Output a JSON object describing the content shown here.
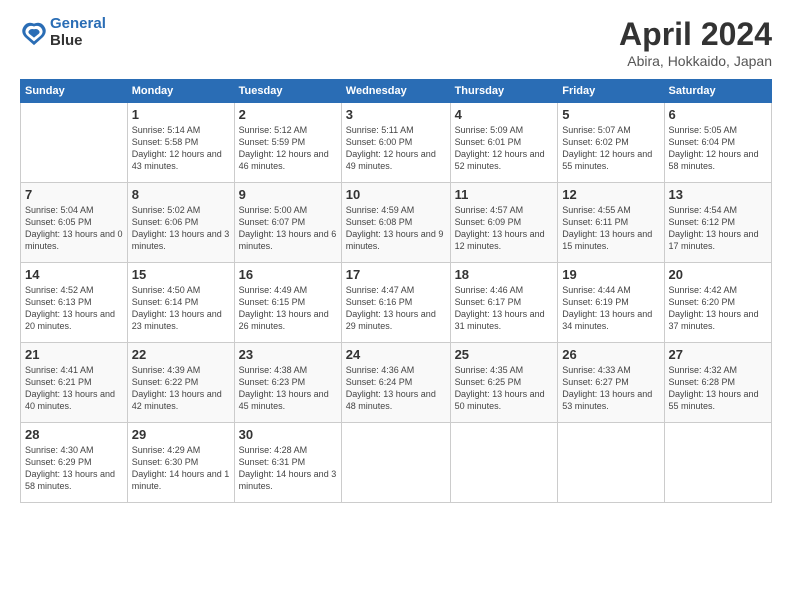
{
  "header": {
    "logo_line1": "General",
    "logo_line2": "Blue",
    "month_title": "April 2024",
    "subtitle": "Abira, Hokkaido, Japan"
  },
  "weekdays": [
    "Sunday",
    "Monday",
    "Tuesday",
    "Wednesday",
    "Thursday",
    "Friday",
    "Saturday"
  ],
  "weeks": [
    [
      {
        "day": "",
        "sunrise": "",
        "sunset": "",
        "daylight": ""
      },
      {
        "day": "1",
        "sunrise": "Sunrise: 5:14 AM",
        "sunset": "Sunset: 5:58 PM",
        "daylight": "Daylight: 12 hours and 43 minutes."
      },
      {
        "day": "2",
        "sunrise": "Sunrise: 5:12 AM",
        "sunset": "Sunset: 5:59 PM",
        "daylight": "Daylight: 12 hours and 46 minutes."
      },
      {
        "day": "3",
        "sunrise": "Sunrise: 5:11 AM",
        "sunset": "Sunset: 6:00 PM",
        "daylight": "Daylight: 12 hours and 49 minutes."
      },
      {
        "day": "4",
        "sunrise": "Sunrise: 5:09 AM",
        "sunset": "Sunset: 6:01 PM",
        "daylight": "Daylight: 12 hours and 52 minutes."
      },
      {
        "day": "5",
        "sunrise": "Sunrise: 5:07 AM",
        "sunset": "Sunset: 6:02 PM",
        "daylight": "Daylight: 12 hours and 55 minutes."
      },
      {
        "day": "6",
        "sunrise": "Sunrise: 5:05 AM",
        "sunset": "Sunset: 6:04 PM",
        "daylight": "Daylight: 12 hours and 58 minutes."
      }
    ],
    [
      {
        "day": "7",
        "sunrise": "Sunrise: 5:04 AM",
        "sunset": "Sunset: 6:05 PM",
        "daylight": "Daylight: 13 hours and 0 minutes."
      },
      {
        "day": "8",
        "sunrise": "Sunrise: 5:02 AM",
        "sunset": "Sunset: 6:06 PM",
        "daylight": "Daylight: 13 hours and 3 minutes."
      },
      {
        "day": "9",
        "sunrise": "Sunrise: 5:00 AM",
        "sunset": "Sunset: 6:07 PM",
        "daylight": "Daylight: 13 hours and 6 minutes."
      },
      {
        "day": "10",
        "sunrise": "Sunrise: 4:59 AM",
        "sunset": "Sunset: 6:08 PM",
        "daylight": "Daylight: 13 hours and 9 minutes."
      },
      {
        "day": "11",
        "sunrise": "Sunrise: 4:57 AM",
        "sunset": "Sunset: 6:09 PM",
        "daylight": "Daylight: 13 hours and 12 minutes."
      },
      {
        "day": "12",
        "sunrise": "Sunrise: 4:55 AM",
        "sunset": "Sunset: 6:11 PM",
        "daylight": "Daylight: 13 hours and 15 minutes."
      },
      {
        "day": "13",
        "sunrise": "Sunrise: 4:54 AM",
        "sunset": "Sunset: 6:12 PM",
        "daylight": "Daylight: 13 hours and 17 minutes."
      }
    ],
    [
      {
        "day": "14",
        "sunrise": "Sunrise: 4:52 AM",
        "sunset": "Sunset: 6:13 PM",
        "daylight": "Daylight: 13 hours and 20 minutes."
      },
      {
        "day": "15",
        "sunrise": "Sunrise: 4:50 AM",
        "sunset": "Sunset: 6:14 PM",
        "daylight": "Daylight: 13 hours and 23 minutes."
      },
      {
        "day": "16",
        "sunrise": "Sunrise: 4:49 AM",
        "sunset": "Sunset: 6:15 PM",
        "daylight": "Daylight: 13 hours and 26 minutes."
      },
      {
        "day": "17",
        "sunrise": "Sunrise: 4:47 AM",
        "sunset": "Sunset: 6:16 PM",
        "daylight": "Daylight: 13 hours and 29 minutes."
      },
      {
        "day": "18",
        "sunrise": "Sunrise: 4:46 AM",
        "sunset": "Sunset: 6:17 PM",
        "daylight": "Daylight: 13 hours and 31 minutes."
      },
      {
        "day": "19",
        "sunrise": "Sunrise: 4:44 AM",
        "sunset": "Sunset: 6:19 PM",
        "daylight": "Daylight: 13 hours and 34 minutes."
      },
      {
        "day": "20",
        "sunrise": "Sunrise: 4:42 AM",
        "sunset": "Sunset: 6:20 PM",
        "daylight": "Daylight: 13 hours and 37 minutes."
      }
    ],
    [
      {
        "day": "21",
        "sunrise": "Sunrise: 4:41 AM",
        "sunset": "Sunset: 6:21 PM",
        "daylight": "Daylight: 13 hours and 40 minutes."
      },
      {
        "day": "22",
        "sunrise": "Sunrise: 4:39 AM",
        "sunset": "Sunset: 6:22 PM",
        "daylight": "Daylight: 13 hours and 42 minutes."
      },
      {
        "day": "23",
        "sunrise": "Sunrise: 4:38 AM",
        "sunset": "Sunset: 6:23 PM",
        "daylight": "Daylight: 13 hours and 45 minutes."
      },
      {
        "day": "24",
        "sunrise": "Sunrise: 4:36 AM",
        "sunset": "Sunset: 6:24 PM",
        "daylight": "Daylight: 13 hours and 48 minutes."
      },
      {
        "day": "25",
        "sunrise": "Sunrise: 4:35 AM",
        "sunset": "Sunset: 6:25 PM",
        "daylight": "Daylight: 13 hours and 50 minutes."
      },
      {
        "day": "26",
        "sunrise": "Sunrise: 4:33 AM",
        "sunset": "Sunset: 6:27 PM",
        "daylight": "Daylight: 13 hours and 53 minutes."
      },
      {
        "day": "27",
        "sunrise": "Sunrise: 4:32 AM",
        "sunset": "Sunset: 6:28 PM",
        "daylight": "Daylight: 13 hours and 55 minutes."
      }
    ],
    [
      {
        "day": "28",
        "sunrise": "Sunrise: 4:30 AM",
        "sunset": "Sunset: 6:29 PM",
        "daylight": "Daylight: 13 hours and 58 minutes."
      },
      {
        "day": "29",
        "sunrise": "Sunrise: 4:29 AM",
        "sunset": "Sunset: 6:30 PM",
        "daylight": "Daylight: 14 hours and 1 minute."
      },
      {
        "day": "30",
        "sunrise": "Sunrise: 4:28 AM",
        "sunset": "Sunset: 6:31 PM",
        "daylight": "Daylight: 14 hours and 3 minutes."
      },
      {
        "day": "",
        "sunrise": "",
        "sunset": "",
        "daylight": ""
      },
      {
        "day": "",
        "sunrise": "",
        "sunset": "",
        "daylight": ""
      },
      {
        "day": "",
        "sunrise": "",
        "sunset": "",
        "daylight": ""
      },
      {
        "day": "",
        "sunrise": "",
        "sunset": "",
        "daylight": ""
      }
    ]
  ]
}
